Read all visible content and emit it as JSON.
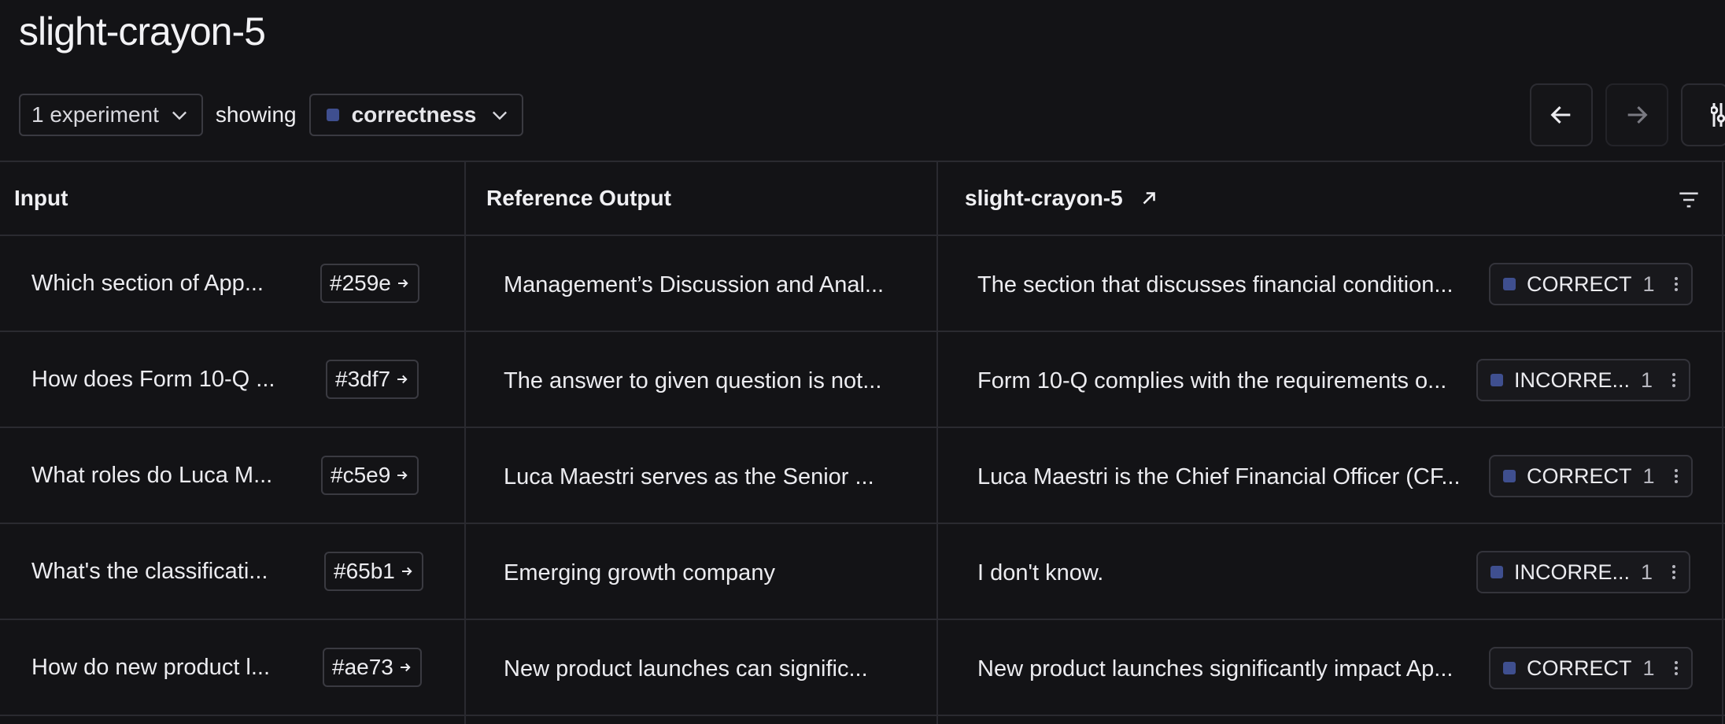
{
  "page": {
    "title": "slight-crayon-5"
  },
  "toolbar": {
    "experiments_label": "1 experiment",
    "showing_label": "showing",
    "metric_label": "correctness",
    "metric_color": "#3f4f8f"
  },
  "table": {
    "headers": {
      "input": "Input",
      "reference": "Reference Output",
      "experiment": "slight-crayon-5"
    },
    "rows": [
      {
        "input": "Which section of App...",
        "id": "#259e",
        "reference": "Management’s Discussion and Anal...",
        "output": "The section that discusses financial condition...",
        "score_label": "CORRECT",
        "score_value": "1"
      },
      {
        "input": "How does Form 10-Q ...",
        "id": "#3df7",
        "reference": "The answer to given question is not...",
        "output": "Form 10-Q complies with the requirements o...",
        "score_label": "INCORRE...",
        "score_value": "1"
      },
      {
        "input": "What roles do Luca M...",
        "id": "#c5e9",
        "reference": "Luca Maestri serves as the Senior ...",
        "output": "Luca Maestri is the Chief Financial Officer (CF...",
        "score_label": "CORRECT",
        "score_value": "1"
      },
      {
        "input": "What's the classificati...",
        "id": "#65b1",
        "reference": "Emerging growth company",
        "output": "I don't know.",
        "score_label": "INCORRE...",
        "score_value": "1"
      },
      {
        "input": "How do new product l...",
        "id": "#ae73",
        "reference": "New product launches can signific...",
        "output": "New product launches significantly impact Ap...",
        "score_label": "CORRECT",
        "score_value": "1"
      }
    ]
  }
}
